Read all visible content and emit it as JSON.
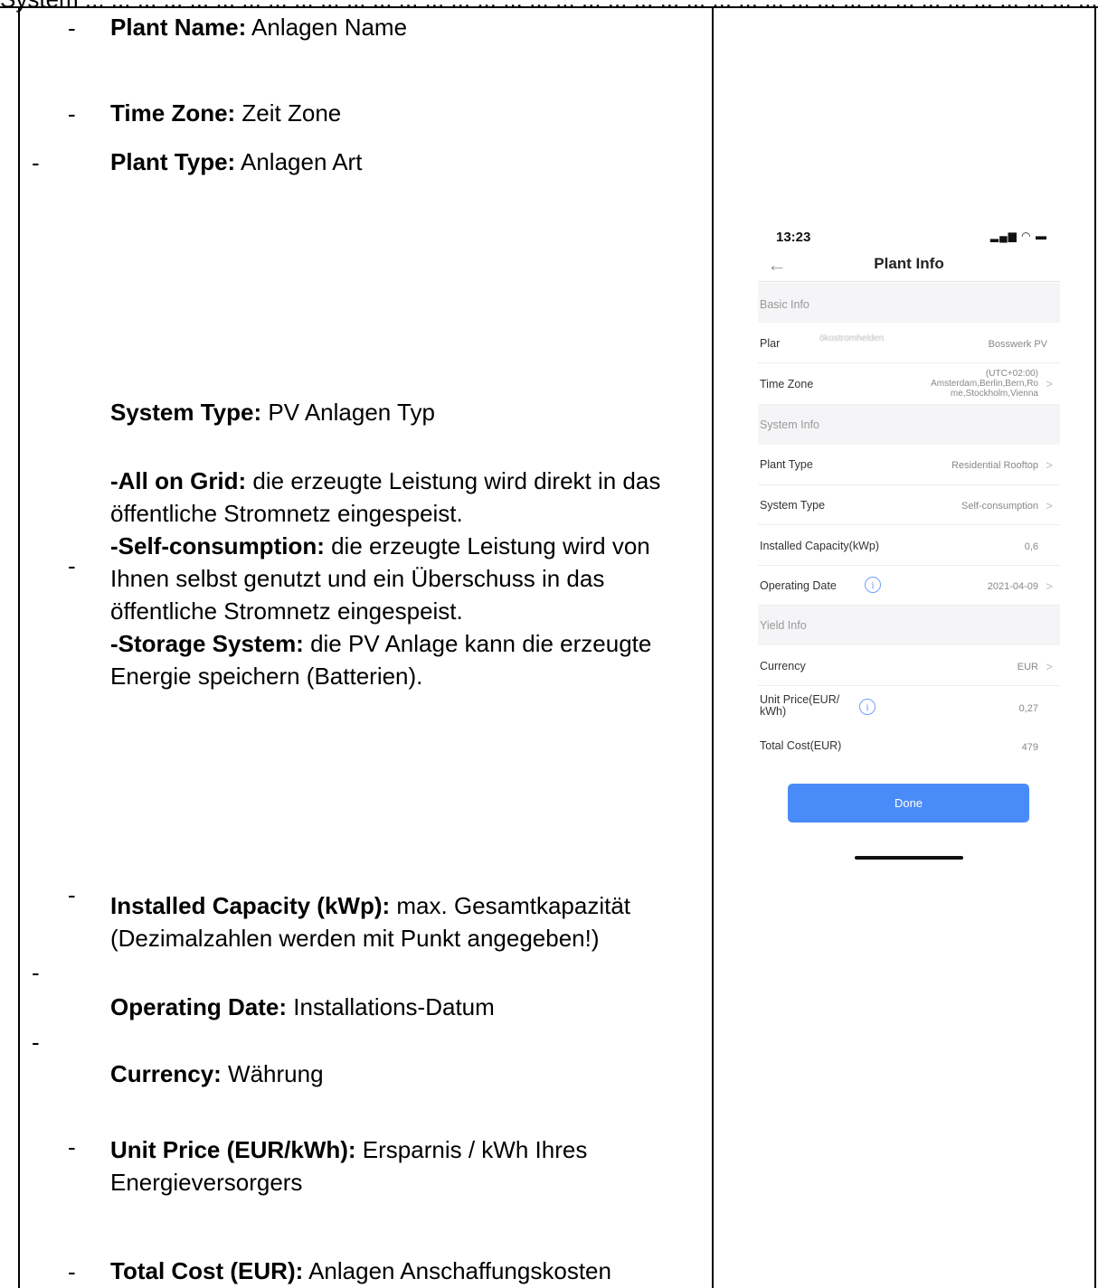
{
  "header_fragment": "System ... ... ... ... ... ... ... ... ... ... ... ... ... ... ... ... ... ... ... ... ... ... ... ... ... ... ... ... ... ... ... ... ... ... ... ... ... ... ... ...„",
  "dash": "-",
  "items": {
    "plant_name": {
      "label": "Plant Name:",
      "text": " Anlagen Name"
    },
    "time_zone": {
      "label": "Time Zone:",
      "text": " Zeit Zone"
    },
    "plant_type": {
      "label": "Plant Type:",
      "text": " Anlagen Art"
    },
    "system_type": {
      "label": "System Type:",
      "text": " PV Anlagen Typ",
      "options": [
        {
          "label": "-All on Grid:",
          "text": " die erzeugte Leistung wird direkt in das öffentliche Stromnetz eingespeist."
        },
        {
          "label": "-Self-consumption:",
          "text": " die erzeugte Leistung wird von Ihnen selbst genutzt und ein Überschuss in das öffentliche Stromnetz eingespeist."
        },
        {
          "label": "-Storage System:",
          "text": " die PV Anlage kann die erzeugte Energie speichern (Batterien)."
        }
      ]
    },
    "installed_capacity": {
      "label": "Installed Capacity (kWp):",
      "text": " max. Gesamtkapazität (Dezimalzahlen werden mit Punkt angegeben!)"
    },
    "operating_date": {
      "label": "Operating Date:",
      "text": " Installations-Datum"
    },
    "currency": {
      "label": "Currency:",
      "text": " Währung"
    },
    "unit_price": {
      "label": "Unit Price (EUR/kWh):",
      "text": " Ersparnis / kWh Ihres Energieversorgers"
    },
    "total_cost": {
      "label": "Total Cost (EUR):",
      "text": " Anlagen Anschaffungskosten"
    }
  },
  "phone": {
    "time": "13:23",
    "status_icons": "▂▄▆ ◠ ▬",
    "title": "Plant Info",
    "back_icon": "←",
    "chevron": ">",
    "info_icon": "i",
    "sections": {
      "basic": "Basic Info",
      "system": "System Info",
      "yield": "Yield Info"
    },
    "rows": {
      "plant_name": {
        "label": "Plar",
        "blurred": "ökostromhelden",
        "value": "Bosswerk PV"
      },
      "time_zone": {
        "label": "Time Zone",
        "value_lines": [
          "(UTC+02:00)",
          "Amsterdam,Berlin,Bern,Ro",
          "me,Stockholm,Vienna"
        ]
      },
      "plant_type": {
        "label": "Plant Type",
        "value": "Residential Rooftop"
      },
      "system_type": {
        "label": "System Type",
        "value": "Self-consumption"
      },
      "installed_capacity": {
        "label": "Installed Capacity(kWp)",
        "value": "0,6"
      },
      "operating_date": {
        "label": "Operating Date",
        "value": "2021-04-09"
      },
      "currency": {
        "label": "Currency",
        "value": "EUR"
      },
      "unit_price": {
        "label_lines": [
          "Unit Price(EUR/",
          "kWh)"
        ],
        "value": "0,27"
      },
      "total_cost": {
        "label": "Total Cost(EUR)",
        "value": "479"
      }
    },
    "done_label": "Done"
  }
}
